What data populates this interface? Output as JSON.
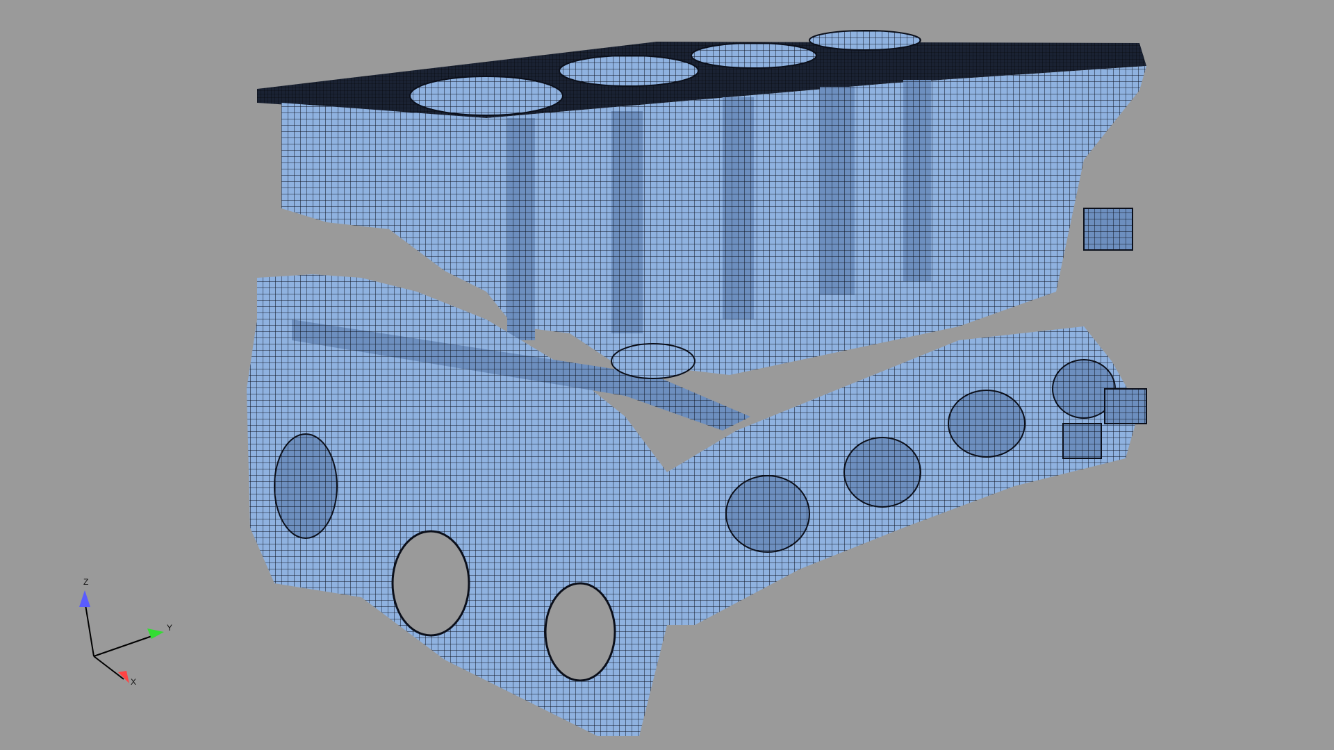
{
  "viewport": {
    "background_color": "#9a9a9a",
    "mesh_fill_color": "#8fb2e0",
    "mesh_line_color": "#0b0f1a",
    "shadow_color": "#1e2a40"
  },
  "model": {
    "icon": "engine-block-mesh"
  },
  "triad": {
    "z_label": "Z",
    "y_label": "Y",
    "x_label": "X",
    "z_color": "#5a5cff",
    "y_color": "#33dd33",
    "x_color": "#ff4444"
  }
}
